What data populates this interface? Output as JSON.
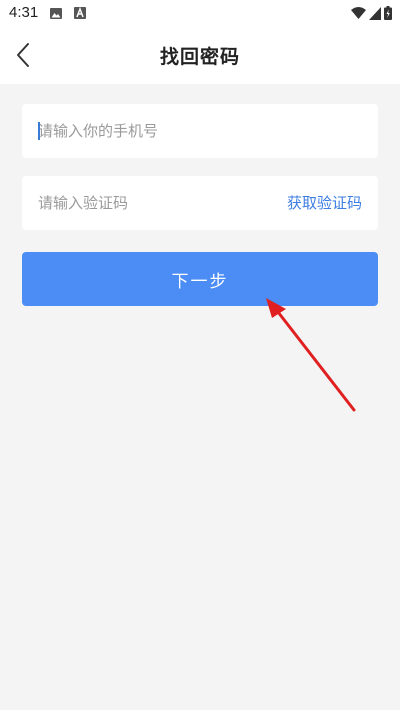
{
  "status_bar": {
    "time": "4:31",
    "icons": [
      "image-icon",
      "a-letter-icon",
      "wifi-icon",
      "signal-icon",
      "battery-icon"
    ]
  },
  "header": {
    "title": "找回密码",
    "back_icon": "chevron-left-icon"
  },
  "form": {
    "phone": {
      "placeholder": "请输入你的手机号",
      "value": ""
    },
    "code": {
      "placeholder": "请输入验证码",
      "value": "",
      "get_code_label": "获取验证码"
    },
    "next_label": "下一步"
  },
  "annotation": {
    "arrow_icon": "red-arrow-icon",
    "color": "#e02020"
  },
  "colors": {
    "background": "#f4f4f4",
    "primary_button": "#4b8cf5",
    "link": "#3e7ee3"
  }
}
